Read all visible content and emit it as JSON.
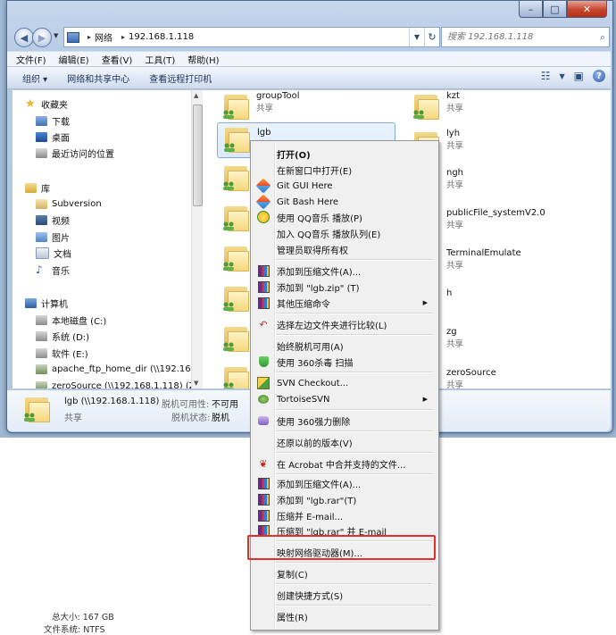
{
  "address": {
    "segments": [
      "网络",
      "192.168.1.118"
    ]
  },
  "search": {
    "placeholder": "搜索 192.168.1.118"
  },
  "menu": [
    "文件(F)",
    "编辑(E)",
    "查看(V)",
    "工具(T)",
    "帮助(H)"
  ],
  "toolbar": {
    "organize": "组织 ▾",
    "network_center": "网络和共享中心",
    "remote_printer": "查看远程打印机"
  },
  "nav": {
    "favorites": "收藏夹",
    "downloads": "下载",
    "desktop": "桌面",
    "recent": "最近访问的位置",
    "libraries": "库",
    "subversion": "Subversion",
    "videos": "视频",
    "pictures": "图片",
    "documents": "文档",
    "music": "音乐",
    "computer": "计算机",
    "local_c": "本地磁盘 (C:)",
    "system_d": "系统 (D:)",
    "software_e": "软件 (E:)",
    "apache": "apache_ftp_home_dir (\\\\192.168.1",
    "zerosource": "zeroSource (\\\\192.168.1.118) (Z:)"
  },
  "files_left": [
    {
      "name": "groupTool",
      "sub": "共享"
    },
    {
      "name": "lgb",
      "sub": "共享"
    }
  ],
  "files_right": [
    {
      "name": "kzt",
      "sub": "共享"
    },
    {
      "name": "lyh",
      "sub": "共享"
    },
    {
      "name": "ngh",
      "sub": "共享"
    },
    {
      "name": "publicFile_systemV2.0",
      "sub": "共享"
    },
    {
      "name": "TerminalEmulate",
      "sub": "共享"
    },
    {
      "name": "h",
      "sub": ""
    },
    {
      "name": "zg",
      "sub": "共享"
    },
    {
      "name": "zeroSource",
      "sub": "共享"
    }
  ],
  "details": {
    "name": "lgb (\\\\192.168.1.118)",
    "share": "共享",
    "offline_avail_label": "脱机可用性:",
    "offline_avail_value": "不可用",
    "offline_status_label": "脱机状态:",
    "offline_status_value": "脱机"
  },
  "behind": {
    "total_label": "总大小:",
    "total_value": "167 GB",
    "fs_label": "文件系统:",
    "fs_value": "NTFS"
  },
  "context_menu": [
    "打开(O)",
    "在新窗口中打开(E)",
    "Git GUI Here",
    "Git Bash Here",
    "使用 QQ音乐 播放(P)",
    "加入 QQ音乐 播放队列(E)",
    "管理员取得所有权",
    "添加到压缩文件(A)...",
    "添加到 \"lgb.zip\" (T)",
    "其他压缩命令",
    "选择左边文件夹进行比较(L)",
    "始终脱机可用(A)",
    "使用 360杀毒 扫描",
    "SVN Checkout...",
    "TortoiseSVN",
    "使用 360强力删除",
    "还原以前的版本(V)",
    "在 Acrobat 中合并支持的文件...",
    "添加到压缩文件(A)...",
    "添加到 \"lgb.rar\"(T)",
    "压缩并 E-mail...",
    "压缩到 \"lgb.rar\" 并 E-mail",
    "映射网络驱动器(M)...",
    "复制(C)",
    "创建快捷方式(S)",
    "属性(R)"
  ],
  "colors": {
    "highlight": "#e0312e",
    "window_chrome": "#b6cbe6"
  }
}
